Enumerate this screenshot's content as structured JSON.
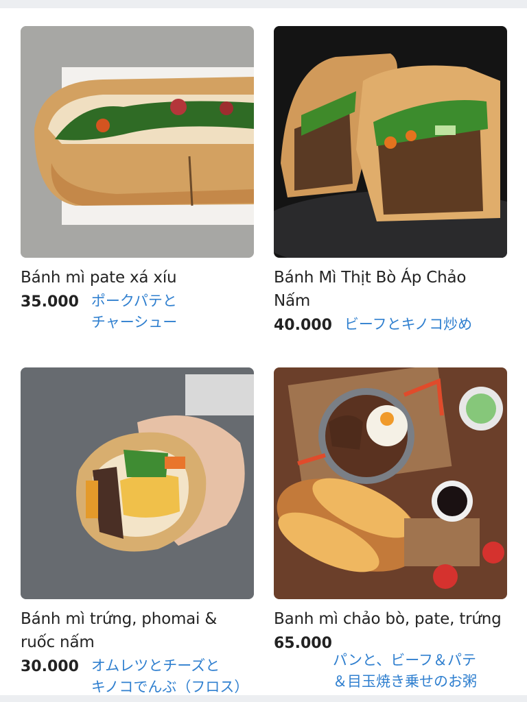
{
  "items": [
    {
      "name": "Bánh mì pate xá xíu",
      "price": "35.000",
      "note": "ポークパテと\nチャーシュー"
    },
    {
      "name": "Bánh Mì Thịt Bò Áp Chảo\nNấm",
      "price": "40.000",
      "note": "ビーフとキノコ炒め"
    },
    {
      "name": "Bánh mì trứng, phomai &\nruốc nấm",
      "price": "30.000",
      "note": "オムレツとチーズと\nキノコでんぶ（フロス）"
    },
    {
      "name": "Banh mì chảo bò, pate, trứng",
      "price": "65.000",
      "note": "パンと、ビーフ＆パテ\n＆目玉焼き乗せのお粥"
    }
  ]
}
